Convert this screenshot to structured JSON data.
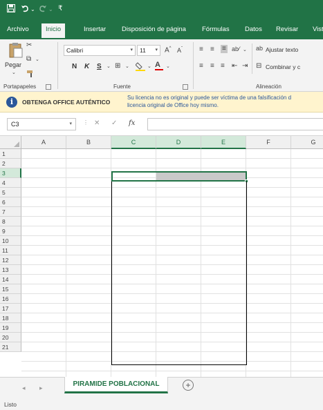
{
  "quick_access": {
    "save_icon": "save-icon",
    "undo_icon": "undo-icon",
    "redo_icon": "redo-icon",
    "customize_icon": "customize-icon"
  },
  "tabs": [
    "Archivo",
    "Inicio",
    "Insertar",
    "Disposición de página",
    "Fórmulas",
    "Datos",
    "Revisar",
    "Vist"
  ],
  "active_tab": "Inicio",
  "ribbon": {
    "clipboard": {
      "paste_label": "Pegar",
      "group_label": "Portapapeles"
    },
    "font": {
      "font_name": "Calibri",
      "font_size": "11",
      "bold": "N",
      "italic": "K",
      "underline": "S",
      "group_label": "Fuente"
    },
    "alignment": {
      "wrap_text": "Ajustar texto",
      "merge": "Combinar y c",
      "group_label": "Alineación"
    }
  },
  "license": {
    "title": "OBTENGA OFFICE AUTÉNTICO",
    "message_line1": "Su licencia no es original y puede ser víctima de una falsificación d",
    "message_line2": "licencia original de Office hoy mismo."
  },
  "formula_bar": {
    "name_box": "C3",
    "fx": "fx",
    "value": ""
  },
  "columns": [
    "A",
    "B",
    "C",
    "D",
    "E",
    "F",
    "G"
  ],
  "rows": [
    "1",
    "2",
    "3",
    "4",
    "5",
    "6",
    "7",
    "8",
    "9",
    "10",
    "11",
    "12",
    "13",
    "14",
    "15",
    "16",
    "17",
    "18",
    "19",
    "20",
    "21"
  ],
  "selection": {
    "active_cell": "C3",
    "range": "C3:E3"
  },
  "sheet": {
    "active_tab": "PIRAMIDE POBLACIONAL",
    "add_sheet": "+"
  },
  "status": {
    "mode": "Listo"
  },
  "colors": {
    "accent": "#217346",
    "license_bg": "#fff4ce",
    "info_icon": "#2b579a"
  }
}
